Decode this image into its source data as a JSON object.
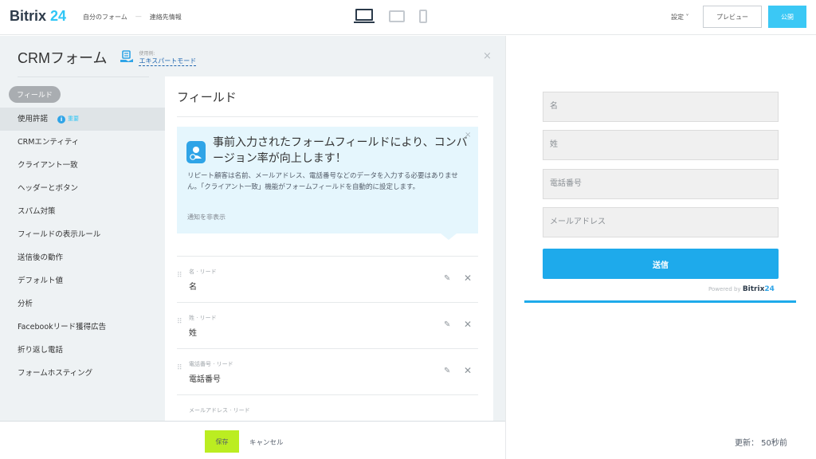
{
  "topbar": {
    "logo_part1": "Bitrix",
    "logo_part2": "24",
    "crumb1": "自分のフォーム",
    "crumb_sep": "—",
    "crumb2": "連絡先情報",
    "settings": "設定 ˅",
    "preview": "プレビュー",
    "publish": "公開"
  },
  "editor": {
    "title": "CRMフォーム",
    "mode_small": "使用例:",
    "mode_link": "エキスパートモード",
    "close": "×"
  },
  "nav": {
    "pill": "フィールド",
    "items": [
      {
        "label": "使用許諾"
      },
      {
        "label": "CRMエンティティ"
      },
      {
        "label": "クライアント一致"
      },
      {
        "label": "ヘッダーとボタン"
      },
      {
        "label": "スパム対策"
      },
      {
        "label": "フィールドの表示ルール"
      },
      {
        "label": "送信後の動作"
      },
      {
        "label": "デフォルト値"
      },
      {
        "label": "分析"
      },
      {
        "label": "Facebookリード獲得広告"
      },
      {
        "label": "折り返し電話"
      },
      {
        "label": "フォームホスティング"
      }
    ],
    "badge_icon": "i",
    "badge_text": "重要"
  },
  "content": {
    "title": "フィールド",
    "tip": {
      "title": "事前入力されたフォームフィールドにより、コンバージョン率が向上します！",
      "body": "リピート顧客は名前、メールアドレス、電話番号などのデータを入力する必要はありません。「クライアント一致」機能がフォームフィールドを自動的に設定します。",
      "hide": "通知を非表示",
      "close": "×"
    },
    "fields": [
      {
        "small": "名 · リード",
        "label": "名"
      },
      {
        "small": "姓 · リード",
        "label": "姓"
      },
      {
        "small": "電話番号 · リード",
        "label": "電話番号"
      },
      {
        "small": "メールアドレス · リード",
        "label": ""
      }
    ]
  },
  "bottom": {
    "save": "保存",
    "cancel": "キャンセル"
  },
  "preview": {
    "inputs": [
      "名",
      "姓",
      "電話番号",
      "メールアドレス"
    ],
    "submit": "送信",
    "powered": "Powered by",
    "powered_brand1": "Bitrix",
    "powered_brand2": "24",
    "updated": "更新： 50秒前"
  },
  "colors": {
    "accent": "#2fc6f6",
    "save_green": "#bbed21",
    "submit_blue": "#1eaaeb"
  }
}
